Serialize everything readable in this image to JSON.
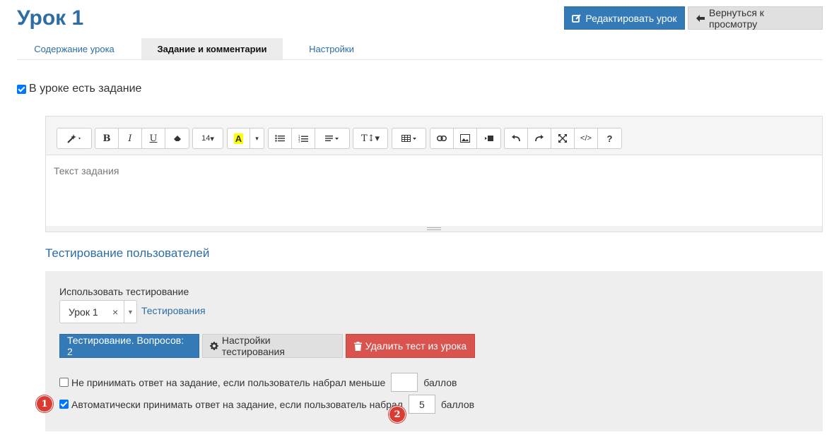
{
  "header": {
    "title": "Урок 1",
    "edit_button": "Редактировать урок",
    "back_button": "Вернуться к просмотру"
  },
  "tabs": [
    {
      "label": "Содержание урока",
      "active": false
    },
    {
      "label": "Задание и комментарии",
      "active": true
    },
    {
      "label": "Настройки",
      "active": false
    }
  ],
  "task": {
    "has_task_label": "В уроке есть задание",
    "has_task_checked": true,
    "editor": {
      "placeholder": "Текст задания",
      "font_size": "14",
      "toolbar_icons": [
        "magic-icon",
        "bold-icon",
        "italic-icon",
        "underline-icon",
        "eraser-icon",
        "font-size-select",
        "text-color-icon",
        "color-dropdown-icon",
        "bulleted-list-icon",
        "numbered-list-icon",
        "align-icon",
        "text-height-icon",
        "table-icon",
        "link-icon",
        "image-icon",
        "video-icon",
        "undo-icon",
        "redo-icon",
        "fullscreen-icon",
        "code-view-icon",
        "help-icon"
      ]
    }
  },
  "testing": {
    "section_title": "Тестирование пользователей",
    "use_testing_label": "Использовать тестирование",
    "selected_test": "Урок 1",
    "tests_link": "Тестирования",
    "questions_button": "Тестирование. Вопросов: 2",
    "settings_button": "Настройки тестирования",
    "delete_button": "Удалить тест из урока",
    "reject_option": {
      "checked": false,
      "label": "Не принимать ответ на задание, если пользователь набрал меньше",
      "value": "",
      "suffix": "баллов"
    },
    "accept_option": {
      "checked": true,
      "label": "Автоматически принимать ответ на задание, если пользователь набрал",
      "value": "5",
      "suffix": "баллов"
    }
  },
  "annotations": {
    "badge1": "1",
    "badge2": "2",
    "badge_color": "#d83c32"
  },
  "colors": {
    "primary": "#337ab7",
    "danger": "#d9534f",
    "link": "#2d6da3"
  }
}
